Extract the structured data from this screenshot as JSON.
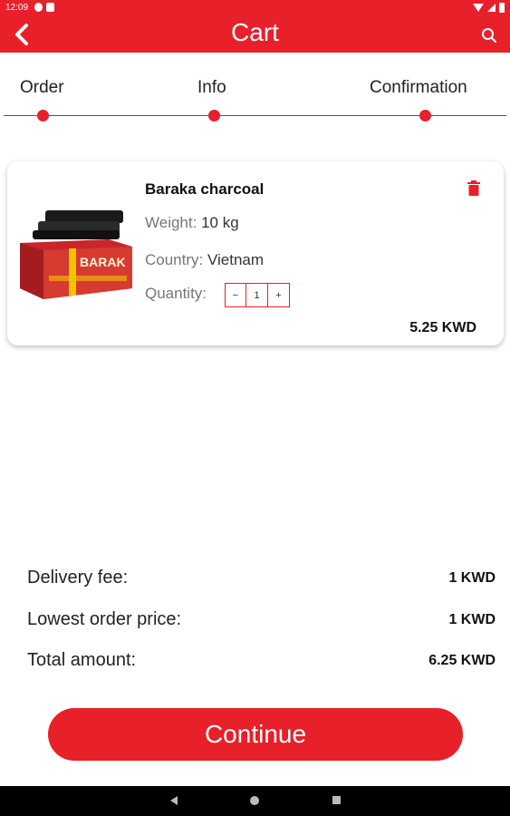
{
  "status_bar": {
    "time": "12:09"
  },
  "header": {
    "title": "Cart",
    "back_icon": "chevron-left-icon",
    "search_icon": "search-icon"
  },
  "steps": [
    {
      "label": "Order"
    },
    {
      "label": "Info"
    },
    {
      "label": "Confirmation"
    }
  ],
  "cart_item": {
    "name": "Baraka charcoal",
    "image_text": "BARAK",
    "weight_label": "Weight:",
    "weight_value": "10 kg",
    "country_label": "Country:",
    "country_value": "Vietnam",
    "quantity_label": "Quantity:",
    "quantity_minus": "−",
    "quantity_value": "1",
    "quantity_plus": "+",
    "price": "5.25 KWD"
  },
  "summary": {
    "delivery_label": "Delivery fee:",
    "delivery_value": "1 KWD",
    "lowest_label": "Lowest order price:",
    "lowest_value": "1 KWD",
    "total_label": "Total amount:",
    "total_value": "6.25 KWD"
  },
  "continue_label": "Continue",
  "colors": {
    "accent": "#e8202a",
    "nav_bar": "#000000"
  }
}
